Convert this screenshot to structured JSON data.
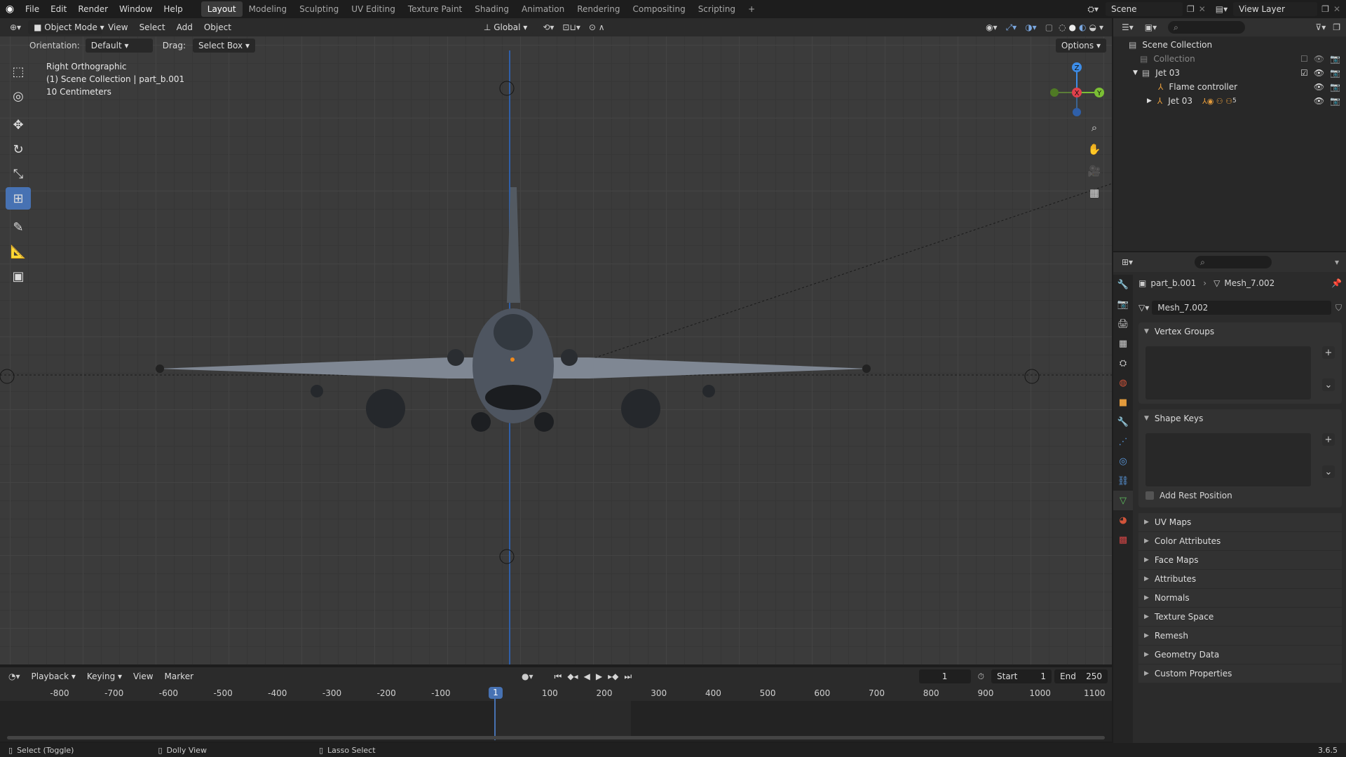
{
  "topbar": {
    "menus": [
      "File",
      "Edit",
      "Render",
      "Window",
      "Help"
    ],
    "workspaces": [
      "Layout",
      "Modeling",
      "Sculpting",
      "UV Editing",
      "Texture Paint",
      "Shading",
      "Animation",
      "Rendering",
      "Compositing",
      "Scripting",
      "+"
    ],
    "active_workspace": "Layout",
    "scene": "Scene",
    "view_layer": "View Layer"
  },
  "viewport_header": {
    "mode": "Object Mode",
    "menus": [
      "View",
      "Select",
      "Add",
      "Object"
    ],
    "transform_orientation": "Global"
  },
  "tool_settings": {
    "orientation_label": "Orientation:",
    "orientation_value": "Default",
    "drag_label": "Drag:",
    "drag_value": "Select Box",
    "options_label": "Options"
  },
  "viewport_overlay": {
    "view_name": "Right Orthographic",
    "collection_info": "(1) Scene Collection | part_b.001",
    "grid_scale": "10 Centimeters"
  },
  "gizmo": {
    "axes": [
      "Z",
      "X",
      "Y"
    ],
    "colors": {
      "x": "#e0404c",
      "y": "#7bbf34",
      "z": "#3d8de8"
    }
  },
  "outliner": {
    "root": "Scene Collection",
    "rows": [
      {
        "label": "Collection",
        "dim": true
      },
      {
        "label": "Jet 03",
        "dim": false
      },
      {
        "label": "Flame controller",
        "dim": false
      },
      {
        "label": "Jet 03",
        "dim": false
      }
    ],
    "badge_count": "5"
  },
  "properties": {
    "breadcrumb_object": "part_b.001",
    "breadcrumb_mesh": "Mesh_7.002",
    "datablock": "Mesh_7.002",
    "vertex_groups": "Vertex Groups",
    "shape_keys": "Shape Keys",
    "add_rest_position": "Add Rest Position",
    "collapsed_panels": [
      "UV Maps",
      "Color Attributes",
      "Face Maps",
      "Attributes",
      "Normals",
      "Texture Space",
      "Remesh",
      "Geometry Data",
      "Custom Properties"
    ]
  },
  "timeline": {
    "menus": [
      "Playback",
      "Keying",
      "View",
      "Marker"
    ],
    "current_frame": "1",
    "start_label": "Start",
    "start_value": "1",
    "end_label": "End",
    "end_value": "250",
    "ticks": [
      "-800",
      "-700",
      "-600",
      "-500",
      "-400",
      "-300",
      "-200",
      "-100",
      "1",
      "100",
      "200",
      "300",
      "400",
      "500",
      "600",
      "700",
      "800",
      "900",
      "1000",
      "1100"
    ]
  },
  "statusbar": {
    "items": [
      "Select (Toggle)",
      "Dolly View",
      "Lasso Select"
    ],
    "version": "3.6.5"
  }
}
